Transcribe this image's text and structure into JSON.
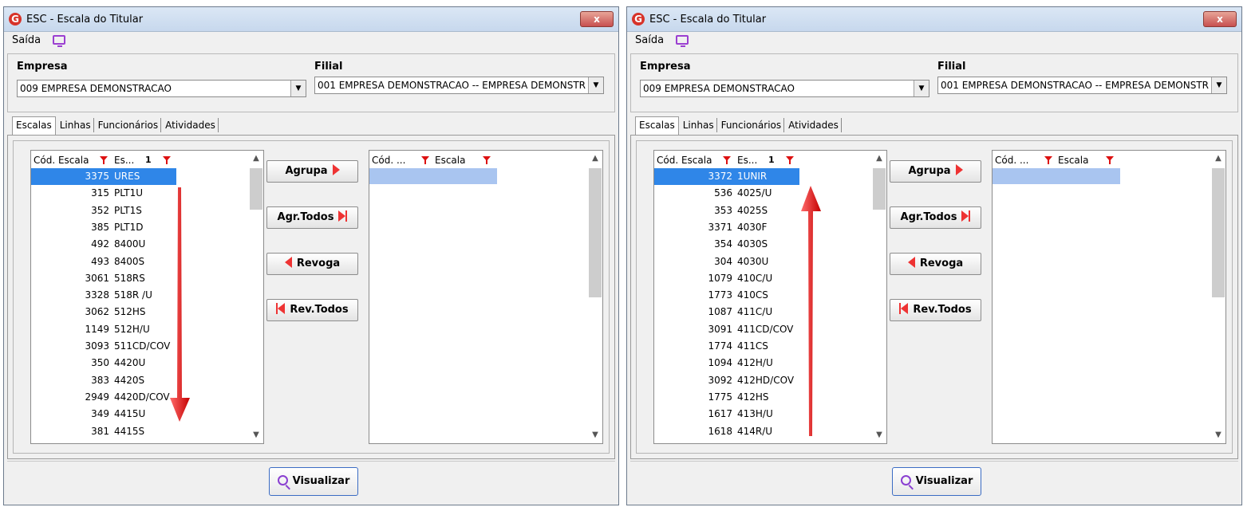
{
  "windows": [
    {
      "title": "ESC - Escala do Titular",
      "app_icon": "G",
      "close_glyph": "x",
      "menu": {
        "saida": "Saída"
      },
      "empresa": {
        "label": "Empresa",
        "value": "009 EMPRESA DEMONSTRACAO"
      },
      "filial": {
        "label": "Filial",
        "value": "001 EMPRESA DEMONSTRACAO -- EMPRESA DEMONSTR"
      },
      "tabs": [
        "Escalas",
        "Linhas",
        "Funcionários",
        "Atividades"
      ],
      "left_grid": {
        "col1": "Cód. Escala",
        "col2": "Es...",
        "sort": "1",
        "rows": [
          {
            "code": "3375",
            "name": "URES"
          },
          {
            "code": "315",
            "name": "PLT1U"
          },
          {
            "code": "352",
            "name": "PLT1S"
          },
          {
            "code": "385",
            "name": "PLT1D"
          },
          {
            "code": "492",
            "name": "8400U"
          },
          {
            "code": "493",
            "name": "8400S"
          },
          {
            "code": "3061",
            "name": "518RS"
          },
          {
            "code": "3328",
            "name": "518R /U"
          },
          {
            "code": "3062",
            "name": "512HS"
          },
          {
            "code": "1149",
            "name": "512H/U"
          },
          {
            "code": "3093",
            "name": "511CD/COV"
          },
          {
            "code": "350",
            "name": "4420U"
          },
          {
            "code": "383",
            "name": "4420S"
          },
          {
            "code": "2949",
            "name": "4420D/COV"
          },
          {
            "code": "349",
            "name": "4415U"
          },
          {
            "code": "381",
            "name": "4415S"
          }
        ]
      },
      "right_grid": {
        "col1": "Cód. ...",
        "col2": "Escala"
      },
      "buttons": {
        "agrupa": "Agrupa",
        "agr_todos": "Agr.Todos",
        "revoga": "Revoga",
        "rev_todos": "Rev.Todos",
        "visualizar": "Visualizar"
      },
      "arrow_direction": "down"
    },
    {
      "title": "ESC - Escala do Titular",
      "app_icon": "G",
      "close_glyph": "x",
      "menu": {
        "saida": "Saída"
      },
      "empresa": {
        "label": "Empresa",
        "value": "009 EMPRESA DEMONSTRACAO"
      },
      "filial": {
        "label": "Filial",
        "value": "001 EMPRESA DEMONSTRACAO -- EMPRESA DEMONSTR"
      },
      "tabs": [
        "Escalas",
        "Linhas",
        "Funcionários",
        "Atividades"
      ],
      "left_grid": {
        "col1": "Cód. Escala",
        "col2": "Es...",
        "sort": "1",
        "rows": [
          {
            "code": "3372",
            "name": "1UNIR"
          },
          {
            "code": "536",
            "name": "4025/U"
          },
          {
            "code": "353",
            "name": "4025S"
          },
          {
            "code": "3371",
            "name": "4030F"
          },
          {
            "code": "354",
            "name": "4030S"
          },
          {
            "code": "304",
            "name": "4030U"
          },
          {
            "code": "1079",
            "name": "410C/U"
          },
          {
            "code": "1773",
            "name": "410CS"
          },
          {
            "code": "1087",
            "name": "411C/U"
          },
          {
            "code": "3091",
            "name": "411CD/COV"
          },
          {
            "code": "1774",
            "name": "411CS"
          },
          {
            "code": "1094",
            "name": "412H/U"
          },
          {
            "code": "3092",
            "name": "412HD/COV"
          },
          {
            "code": "1775",
            "name": "412HS"
          },
          {
            "code": "1617",
            "name": "413H/U"
          },
          {
            "code": "1618",
            "name": "414R/U"
          }
        ]
      },
      "right_grid": {
        "col1": "Cód. ...",
        "col2": "Escala"
      },
      "buttons": {
        "agrupa": "Agrupa",
        "agr_todos": "Agr.Todos",
        "revoga": "Revoga",
        "rev_todos": "Rev.Todos",
        "visualizar": "Visualizar"
      },
      "arrow_direction": "up"
    }
  ],
  "colors": {
    "selection": "#2f86e8",
    "accent_red": "#e33",
    "visualizar_border": "#3b6cc4"
  }
}
